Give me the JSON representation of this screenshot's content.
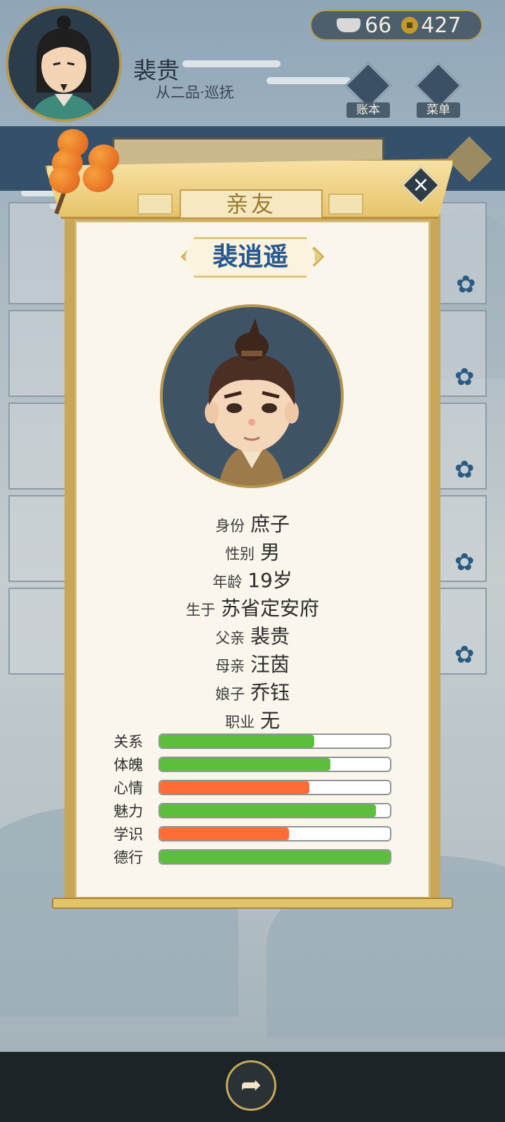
{
  "header": {
    "player_name": "裴贵",
    "player_rank": "从二品·巡抚",
    "silver": "66",
    "coins": "427",
    "ledger_label": "账本",
    "menu_label": "菜单"
  },
  "background_tab_title": "亲友",
  "popup": {
    "title": "亲友",
    "name": "裴逍遥",
    "fields": [
      {
        "key": "身份",
        "value": "庶子"
      },
      {
        "key": "性别",
        "value": "男"
      },
      {
        "key": "年龄",
        "value": "19岁"
      },
      {
        "key": "生于",
        "value": "苏省定安府"
      },
      {
        "key": "父亲",
        "value": "裴贵"
      },
      {
        "key": "母亲",
        "value": "汪茵"
      },
      {
        "key": "娘子",
        "value": "乔钰"
      },
      {
        "key": "职业",
        "value": "无"
      }
    ],
    "stats": [
      {
        "label": "关系",
        "fraction": 0.67,
        "color": "#5cbf3c"
      },
      {
        "label": "体魄",
        "fraction": 0.74,
        "color": "#5cbf3c"
      },
      {
        "label": "心情",
        "fraction": 0.65,
        "color": "#ff6c36"
      },
      {
        "label": "魅力",
        "fraction": 0.94,
        "color": "#5cbf3c"
      },
      {
        "label": "学识",
        "fraction": 0.56,
        "color": "#ff6c36"
      },
      {
        "label": "德行",
        "fraction": 1.0,
        "color": "#5cbf3c"
      }
    ]
  },
  "icons": {
    "close": "close-icon",
    "share": "share-icon",
    "silver": "silver-ingot-icon",
    "coin": "copper-coin-icon"
  }
}
